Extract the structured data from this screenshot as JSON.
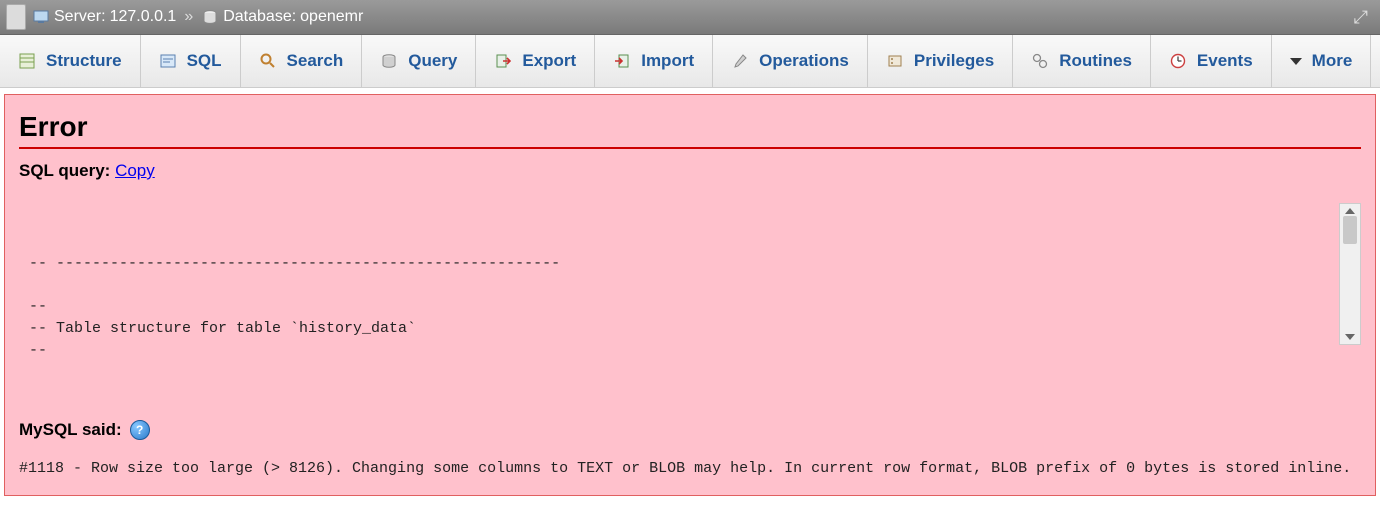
{
  "breadcrumb": {
    "server_label": "Server:",
    "server_value": "127.0.0.1",
    "separator": "»",
    "database_label": "Database:",
    "database_value": "openemr"
  },
  "tabs": {
    "structure": "Structure",
    "sql": "SQL",
    "search": "Search",
    "query": "Query",
    "export": "Export",
    "import": "Import",
    "operations": "Operations",
    "privileges": "Privileges",
    "routines": "Routines",
    "events": "Events",
    "more": "More"
  },
  "error": {
    "title": "Error",
    "sql_query_label": "SQL query:",
    "copy_label": "Copy",
    "code": "-- --------------------------------------------------------\n\n--\n-- Table structure for table `history_data`\n--",
    "mysql_said_label": "MySQL said:",
    "message": "#1118 - Row size too large (> 8126). Changing some columns to TEXT or BLOB may help. In current row format, BLOB prefix of 0 bytes is stored inline."
  }
}
